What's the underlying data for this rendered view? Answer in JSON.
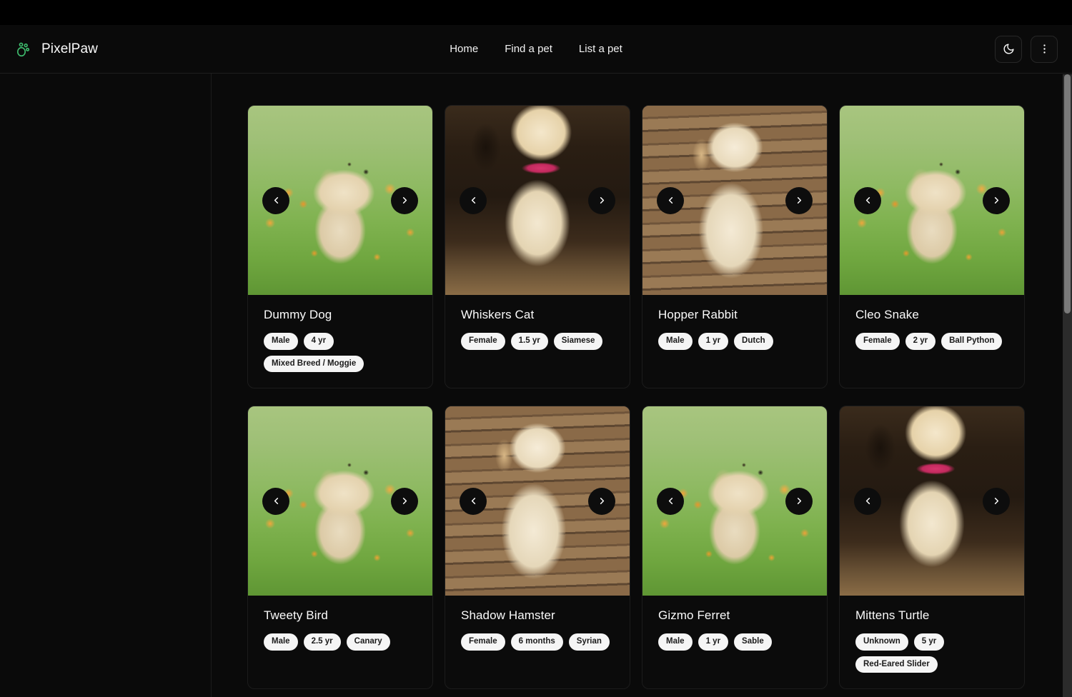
{
  "header": {
    "brand_name": "PixelPaw",
    "logo_icon": "paw-icon",
    "logo_color": "#3fbf6f",
    "nav": [
      {
        "label": "Home"
      },
      {
        "label": "Find a pet"
      },
      {
        "label": "List a pet"
      }
    ],
    "actions": [
      {
        "icon": "moon-icon",
        "label": "Toggle dark mode"
      },
      {
        "icon": "more-vertical-icon",
        "label": "More options"
      }
    ]
  },
  "carousel": {
    "prev_icon": "chevron-left-icon",
    "next_icon": "chevron-right-icon"
  },
  "pets": [
    {
      "name": "Dummy Dog",
      "photo": "grass",
      "badges": [
        "Male",
        "4 yr",
        "Mixed Breed / Moggie"
      ]
    },
    {
      "name": "Whiskers Cat",
      "photo": "indoor",
      "badges": [
        "Female",
        "1.5 yr",
        "Siamese"
      ]
    },
    {
      "name": "Hopper Rabbit",
      "photo": "deck",
      "badges": [
        "Male",
        "1 yr",
        "Dutch"
      ]
    },
    {
      "name": "Cleo Snake",
      "photo": "grass",
      "badges": [
        "Female",
        "2 yr",
        "Ball Python"
      ]
    },
    {
      "name": "Tweety Bird",
      "photo": "grass",
      "badges": [
        "Male",
        "2.5 yr",
        "Canary"
      ]
    },
    {
      "name": "Shadow Hamster",
      "photo": "deck",
      "badges": [
        "Female",
        "6 months",
        "Syrian"
      ]
    },
    {
      "name": "Gizmo Ferret",
      "photo": "grass",
      "badges": [
        "Male",
        "1 yr",
        "Sable"
      ]
    },
    {
      "name": "Mittens Turtle",
      "photo": "indoor",
      "badges": [
        "Unknown",
        "5 yr",
        "Red-Eared Slider"
      ]
    }
  ],
  "colors": {
    "background": "#0a0a0a",
    "card_background": "#0b0b0b",
    "border": "#1c1c1c",
    "text_primary": "#fafafa",
    "badge_background": "#f5f5f5",
    "badge_text": "#1b1b1b",
    "accent_green": "#3fbf6f"
  }
}
